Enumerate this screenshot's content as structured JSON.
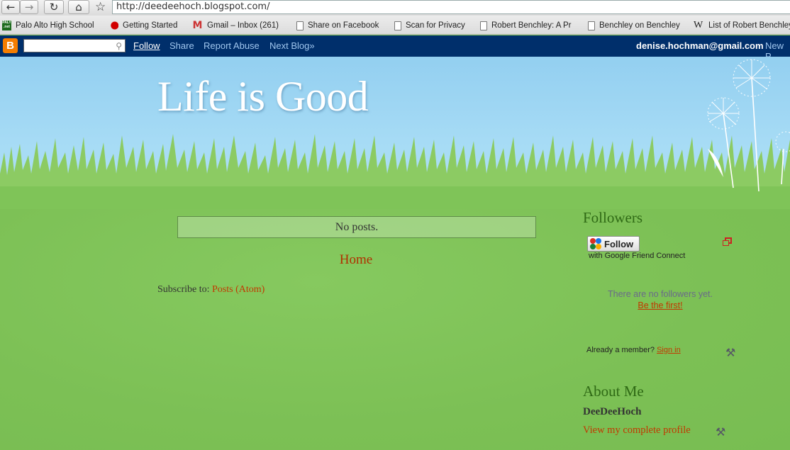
{
  "browser": {
    "url": "http://deedeehoch.blogspot.com/",
    "bookmarks": [
      {
        "label": "Palo Alto High School",
        "icon": "paly-icon"
      },
      {
        "label": "Getting Started",
        "icon": "firefox-icon"
      },
      {
        "label": "Gmail – Inbox (261)",
        "icon": "gmail-icon"
      },
      {
        "label": "Share on Facebook",
        "icon": "page-icon"
      },
      {
        "label": "Scan for Privacy",
        "icon": "page-icon"
      },
      {
        "label": "Robert Benchley: A Pr",
        "icon": "page-icon"
      },
      {
        "label": "Benchley on Benchley",
        "icon": "page-icon"
      },
      {
        "label": "List of Robert Benchley",
        "icon": "wikipedia-icon"
      }
    ]
  },
  "navbar": {
    "logo": "B",
    "search_value": "",
    "links": [
      "Follow",
      "Share",
      "Report Abuse",
      "Next Blog»"
    ],
    "user_email": "denise.hochman@gmail.com",
    "new_post": "New P"
  },
  "header": {
    "title": "Life is Good"
  },
  "main": {
    "no_posts": "No posts.",
    "home_link": "Home",
    "subscribe_label": "Subscribe to:",
    "subscribe_link": "Posts (Atom)"
  },
  "sidebar": {
    "followers": {
      "title": "Followers",
      "follow_button": "Follow",
      "gfc_text": "with Google Friend Connect",
      "no_followers": "There are no followers yet.",
      "be_first": "Be the first!",
      "already_member": "Already a member?",
      "sign_in": "Sign in"
    },
    "about": {
      "title": "About Me",
      "name": "DeeDeeHoch",
      "profile_link": "View my complete profile"
    }
  },
  "colors": {
    "navbar_bg": "#002f6b",
    "sky": "#a6dbf5",
    "grass": "#7fc458",
    "link": "#c23800",
    "widget_title": "#2f6a15"
  }
}
